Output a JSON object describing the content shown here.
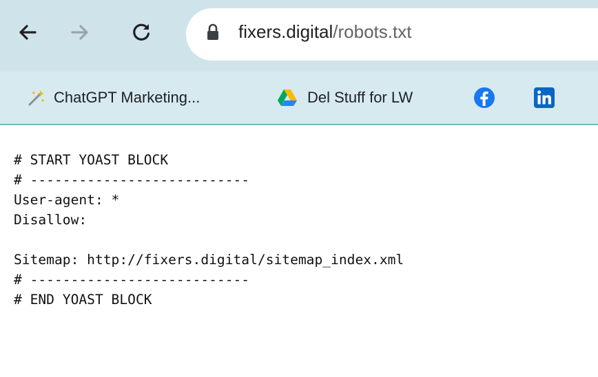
{
  "browser": {
    "nav": {
      "back_icon": "arrow-left-icon",
      "forward_icon": "arrow-right-icon",
      "reload_icon": "reload-icon"
    },
    "address_bar": {
      "lock_icon": "lock-icon",
      "domain": "fixers.digital",
      "path": "/robots.txt"
    },
    "bookmarks": [
      {
        "label": "ChatGPT Marketing...",
        "icon": "magic-wand-icon"
      },
      {
        "label": "Del Stuff for LW",
        "icon": "google-drive-icon"
      },
      {
        "label": "",
        "icon": "facebook-icon"
      },
      {
        "label": "",
        "icon": "linkedin-icon"
      }
    ],
    "colors": {
      "toolbar_bg": "#cfe4ea",
      "bookmarks_bg": "#d6eaf0",
      "facebook_blue": "#1877f2",
      "linkedin_blue": "#0a66c2"
    }
  },
  "document": {
    "lines": [
      "# START YOAST BLOCK",
      "# ---------------------------",
      "User-agent: *",
      "Disallow:",
      "",
      "Sitemap: http://fixers.digital/sitemap_index.xml",
      "# ---------------------------",
      "# END YOAST BLOCK"
    ]
  }
}
